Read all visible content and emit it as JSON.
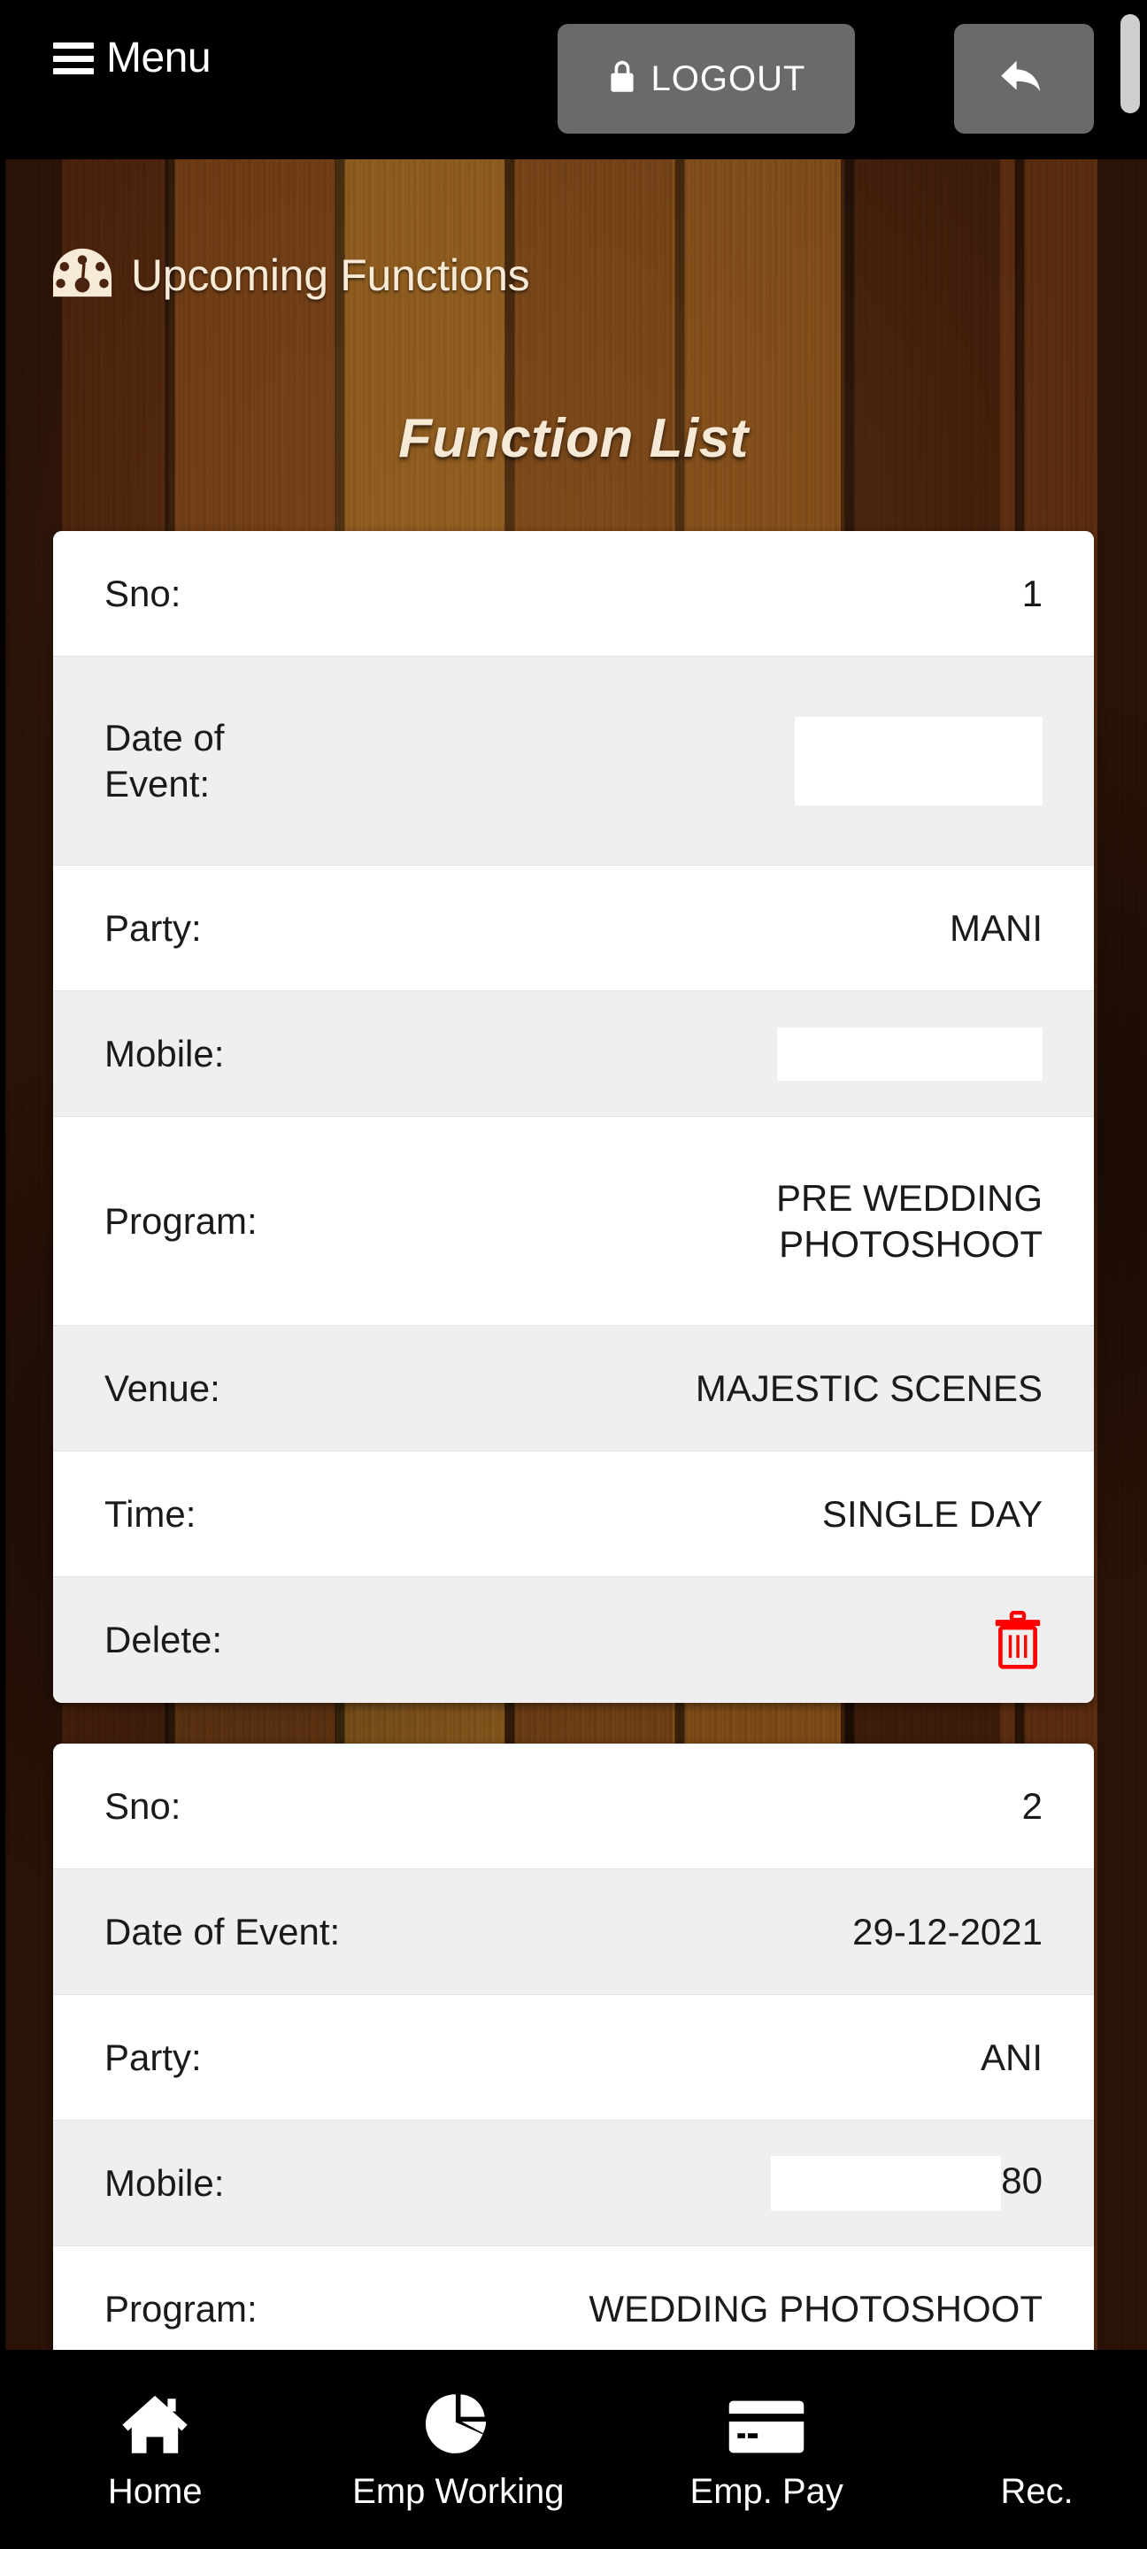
{
  "topbar": {
    "menu_label": "Menu",
    "menu_icon": "hamburger-icon",
    "logout_label": "LOGOUT",
    "logout_icon": "lock-icon",
    "back_icon": "reply-arrow-icon",
    "button_color": "#6a6a6a",
    "background": "#000000"
  },
  "header": {
    "title": "Upcoming Functions",
    "icon": "speedometer-icon",
    "list_title": "Function List",
    "text_color": "#f6e9d6"
  },
  "cards": [
    {
      "rows": [
        {
          "label": "Sno:",
          "value": "1"
        },
        {
          "label": "Date of Event:",
          "value": "",
          "redacted": true
        },
        {
          "label": "Party:",
          "value": "MANI"
        },
        {
          "label": "Mobile:",
          "value": "",
          "redacted": true
        },
        {
          "label": "Program:",
          "value": "PRE WEDDING\nPHOTOSHOOT"
        },
        {
          "label": "Venue:",
          "value": "MAJESTIC SCENES"
        },
        {
          "label": "Time:",
          "value": "SINGLE DAY"
        },
        {
          "label": "Delete:",
          "value": "",
          "icon": "trash-icon"
        }
      ]
    },
    {
      "rows": [
        {
          "label": "Sno:",
          "value": "2"
        },
        {
          "label": "Date of Event:",
          "value": "29-12-2021"
        },
        {
          "label": "Party:",
          "value": "ANI"
        },
        {
          "label": "Mobile:",
          "value": "80",
          "redacted": true
        },
        {
          "label": "Program:",
          "value": "WEDDING PHOTOSHOOT"
        }
      ]
    }
  ],
  "bottomnav": {
    "items": [
      {
        "label": "Home",
        "icon": "home-icon"
      },
      {
        "label": "Emp Working",
        "icon": "pie-chart-icon"
      },
      {
        "label": "Emp. Pay",
        "icon": "credit-card-icon"
      },
      {
        "label": "Rec.",
        "icon": "receipt-icon"
      }
    ],
    "background": "#000000"
  },
  "colors": {
    "delete_icon": "#ff0000",
    "card_background": "#ffffff",
    "card_alt_row": "#efefef",
    "wood_dark": "#2a1207",
    "wood_light": "#8a5a1e"
  }
}
